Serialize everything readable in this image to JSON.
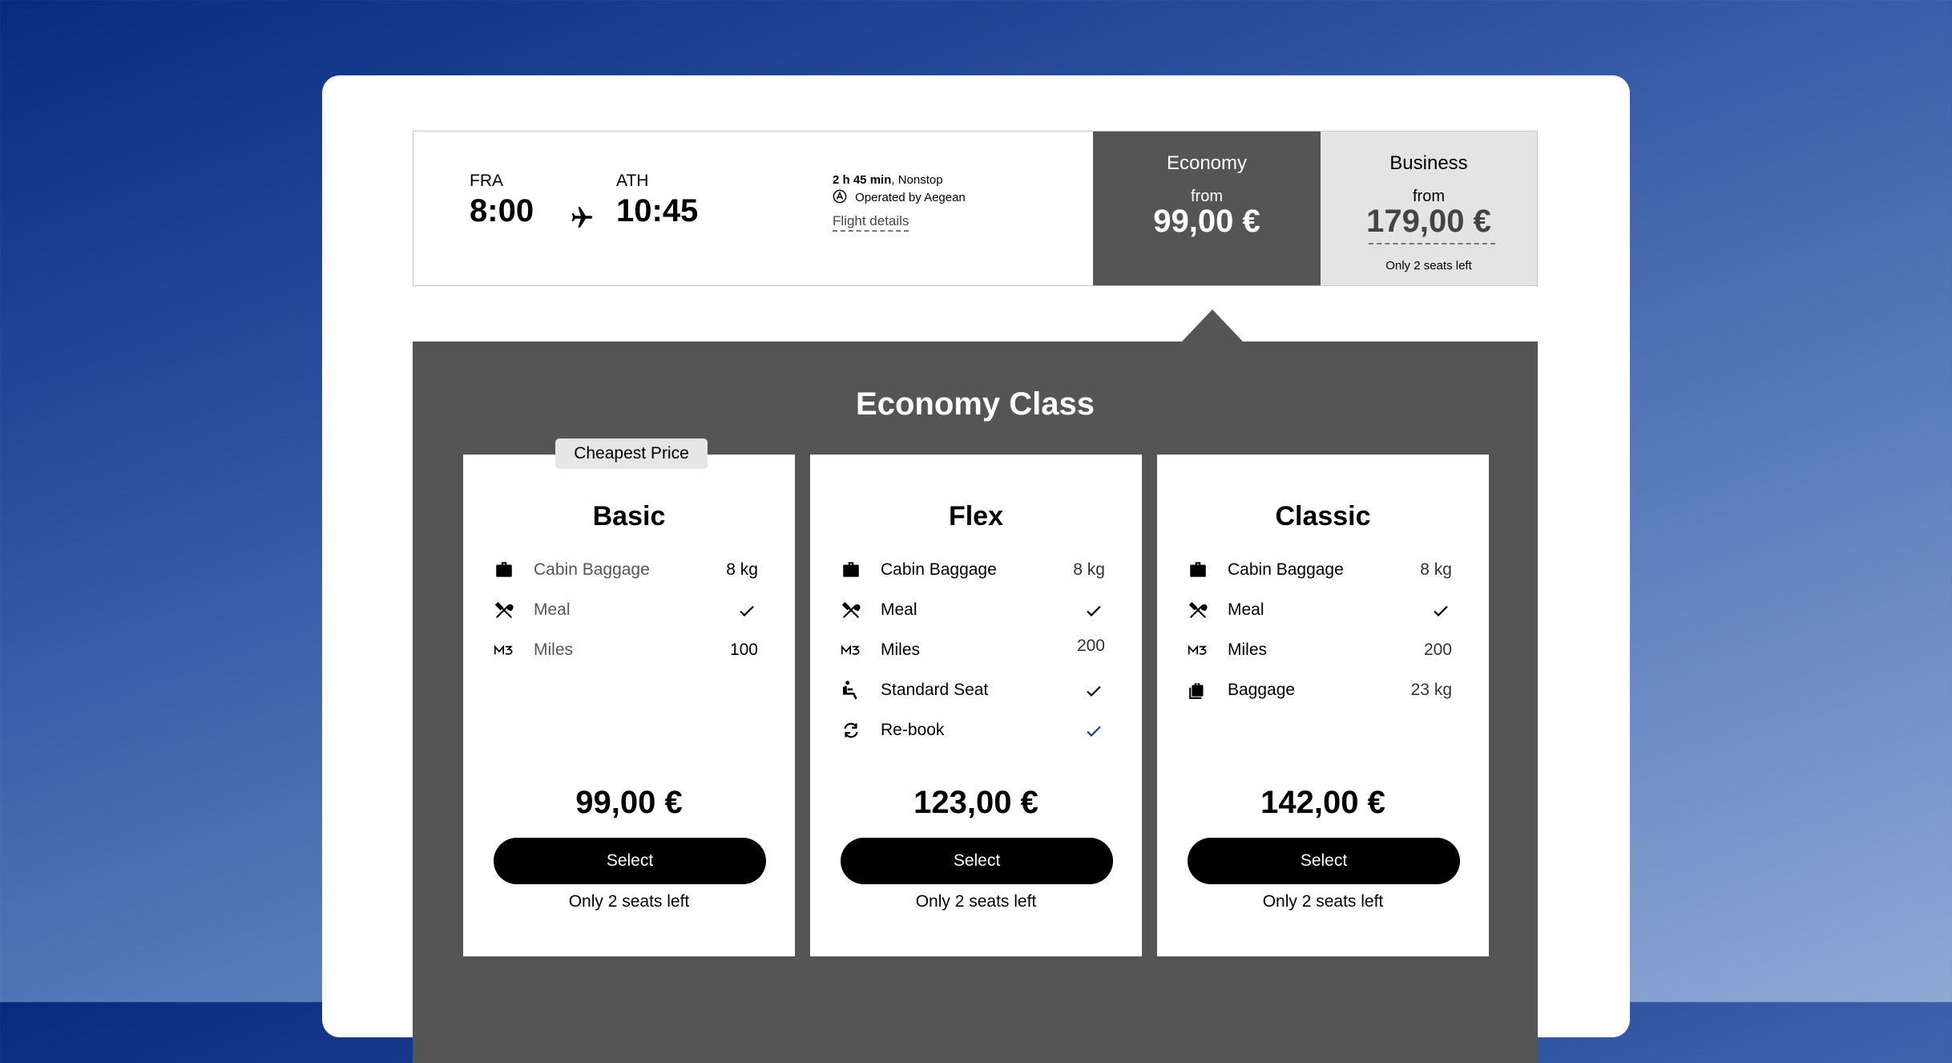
{
  "flight": {
    "origin_code": "FRA",
    "origin_time": "8:00",
    "destination_code": "ATH",
    "destination_time": "10:45",
    "duration": "2 h 45 min",
    "stops": ", Nonstop",
    "operated_by": "Operated by Aegean",
    "details_link": "Flight details",
    "icons": [
      "plane-icon",
      "aegean-logo-icon"
    ]
  },
  "fares": {
    "economy": {
      "title": "Economy",
      "from": "from",
      "price": "99,00 €"
    },
    "business": {
      "title": "Business",
      "from": "from",
      "price": "179,00 €",
      "seats": "Only 2 seats left"
    }
  },
  "section": {
    "title": "Economy Class"
  },
  "cards": [
    {
      "name": "Basic",
      "badge": "Cheapest Price",
      "features": [
        {
          "icon": "suitcase-icon",
          "label": "Cabin Baggage",
          "value": "8 kg"
        },
        {
          "icon": "cutlery-icon",
          "label": "Meal",
          "value": "check"
        },
        {
          "icon": "miles-icon",
          "label": "Miles",
          "value": "100"
        }
      ],
      "price": "99,00 €",
      "select": "Select",
      "seats": "Only 2 seats left"
    },
    {
      "name": "Flex",
      "features": [
        {
          "icon": "suitcase-icon",
          "label": "Cabin Baggage",
          "value": "8 kg"
        },
        {
          "icon": "cutlery-icon",
          "label": "Meal",
          "value": "check"
        },
        {
          "icon": "miles-icon",
          "label": "Miles",
          "value": "200"
        },
        {
          "icon": "seat-icon",
          "label": "Standard Seat",
          "value": "check"
        },
        {
          "icon": "rebook-icon",
          "label": "Re-book",
          "value": "check"
        }
      ],
      "price": "123,00 €",
      "select": "Select",
      "seats": "Only 2 seats left"
    },
    {
      "name": "Classic",
      "features": [
        {
          "icon": "suitcase-icon",
          "label": "Cabin Baggage",
          "value": "8 kg"
        },
        {
          "icon": "cutlery-icon",
          "label": "Meal",
          "value": "check"
        },
        {
          "icon": "miles-icon",
          "label": "Miles",
          "value": "200"
        },
        {
          "icon": "baggage-icon",
          "label": "Baggage",
          "value": "23 kg"
        }
      ],
      "price": "142,00 €",
      "select": "Select",
      "seats": "Only 2 seats left"
    }
  ],
  "colors": {
    "panel": "#ffffff",
    "economy_bg": "#555555",
    "business_bg": "#e4e4e4",
    "button": "#000000",
    "rebook_check": "#1f3f7a"
  }
}
